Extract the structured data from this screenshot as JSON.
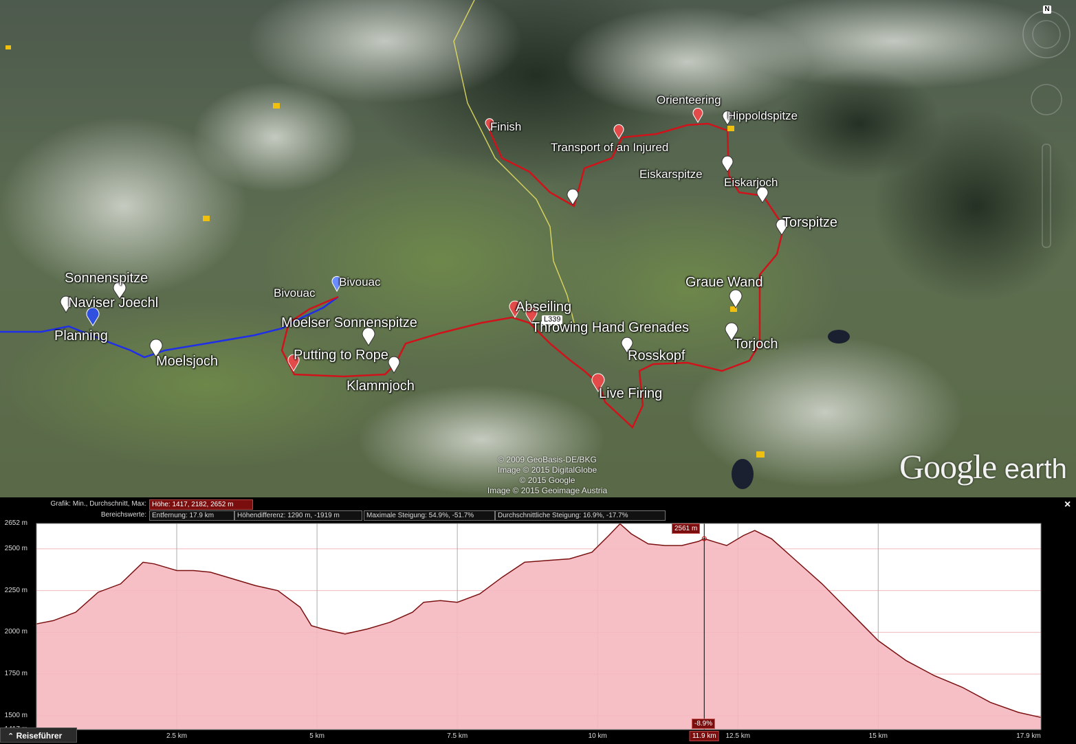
{
  "map": {
    "north_label": "N",
    "road_label": "L339",
    "copyright": [
      "© 2009 GeoBasis-DE/BKG",
      "Image © 2015 DigitalGlobe",
      "© 2015 Google",
      "Image © 2015 Geoimage Austria"
    ],
    "brand_google": "Google",
    "brand_earth": "earth",
    "route_colors": {
      "red": "#d0121b",
      "blue": "#1f2ee8",
      "border": "#e8e060"
    },
    "places": {
      "finish": "Finish",
      "orienteering": "Orienteering",
      "hippoldspitze": "Hippoldspitze",
      "transport": "Transport of an Injured",
      "eiskarspitze": "Eiskarspitze",
      "eiskarjoch": "Eiskarjoch",
      "torspitze": "Torspitze",
      "graue_wand": "Graue Wand",
      "torjoch": "Torjoch",
      "rosskopf": "Rosskopf",
      "live_firing": "Live Firing",
      "throwing": "Throwing Hand Grenades",
      "abseiling": "Abseiling",
      "bivouac_left": "Bivouac",
      "bivouac_right": "Bivouac",
      "moelser": "Moelser Sonnenspitze",
      "putting": "Putting to Rope",
      "klammjoch": "Klammjoch",
      "sonnenspitze": "Sonnenspitze",
      "naviser": "Naviser Joechl",
      "planning": "Planning",
      "moelsjoch": "Moelsjoch"
    }
  },
  "profile": {
    "graph_label": "Grafik: Min., Durchschnitt, Max:",
    "height_box": "Höhe: 1417, 2182, 2652 m",
    "range_label": "Bereichswerte:",
    "distance_box": "Entfernung: 17.9 km",
    "height_diff_box": "Höhendifferenz: 1290 m, -1919 m",
    "max_slope_box": "Maximale Steigung: 54.9%, -51.7%",
    "avg_slope_box": "Durchschnittliche Steigung: 16.9%, -17.7%",
    "close": "×",
    "cursor_elevation": "2561 m",
    "cursor_slope": "-8.9%",
    "guide_button": "Reiseführer",
    "guide_icon": "double-chevron-up-icon"
  },
  "chart_data": {
    "type": "area",
    "xlabel": "",
    "ylabel": "",
    "xlim": [
      0,
      17.9
    ],
    "ylim": [
      1417,
      2652
    ],
    "x_ticks": [
      "2.5 km",
      "5 km",
      "7.5 km",
      "10 km",
      "11.9 km",
      "12.5 km",
      "15 km",
      "17.9 km"
    ],
    "x_tick_values": [
      2.5,
      5,
      7.5,
      10,
      11.9,
      12.5,
      15,
      17.9
    ],
    "highlighted_x_tick": "11.9 km",
    "y_ticks": [
      "2652 m",
      "2500 m",
      "2250 m",
      "2000 m",
      "1750 m",
      "1500 m",
      "1417 m"
    ],
    "y_tick_values": [
      2652,
      2500,
      2250,
      2000,
      1750,
      1500,
      1417
    ],
    "cursor_x": 11.9,
    "fill_color": "#f5b8c0",
    "line_color": "#7a1010",
    "x": [
      0,
      0.3,
      0.7,
      1.1,
      1.5,
      1.9,
      2.1,
      2.5,
      2.8,
      3.1,
      3.5,
      3.9,
      4.3,
      4.7,
      4.9,
      5.1,
      5.5,
      5.9,
      6.3,
      6.7,
      6.9,
      7.2,
      7.5,
      7.9,
      8.3,
      8.7,
      9.1,
      9.5,
      9.9,
      10.2,
      10.4,
      10.6,
      10.9,
      11.2,
      11.5,
      11.8,
      11.9,
      12.1,
      12.3,
      12.6,
      12.8,
      13.1,
      13.5,
      14.0,
      14.5,
      15.0,
      15.5,
      16.0,
      16.5,
      17.0,
      17.5,
      17.9
    ],
    "elevation_m": [
      2050,
      2070,
      2120,
      2240,
      2290,
      2420,
      2410,
      2370,
      2370,
      2360,
      2320,
      2280,
      2250,
      2150,
      2040,
      2020,
      1990,
      2020,
      2060,
      2120,
      2180,
      2190,
      2180,
      2230,
      2330,
      2420,
      2430,
      2440,
      2480,
      2580,
      2650,
      2590,
      2530,
      2520,
      2520,
      2545,
      2561,
      2540,
      2520,
      2580,
      2610,
      2560,
      2440,
      2290,
      2120,
      1950,
      1830,
      1740,
      1670,
      1580,
      1520,
      1490
    ]
  }
}
